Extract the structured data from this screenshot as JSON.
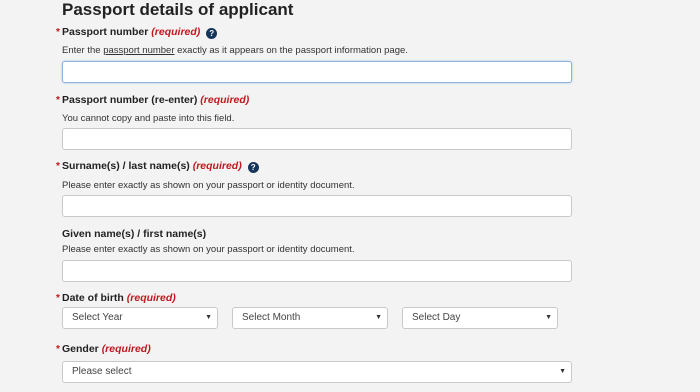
{
  "section": {
    "title": "Passport details of applicant"
  },
  "required_text": "(required)",
  "passport_number": {
    "label": "Passport number",
    "help_before": "Enter the ",
    "help_link": "passport number",
    "help_after": " exactly as it appears on the passport information page.",
    "value": ""
  },
  "passport_reenter": {
    "label": "Passport number (re-enter)",
    "help": "You cannot copy and paste into this field.",
    "value": ""
  },
  "surname": {
    "label": "Surname(s) / last name(s)",
    "help": "Please enter exactly as shown on your passport or identity document.",
    "value": ""
  },
  "given_name": {
    "label": "Given name(s) / first name(s)",
    "help": "Please enter exactly as shown on your passport or identity document.",
    "value": ""
  },
  "dob": {
    "label": "Date of birth",
    "year_placeholder": "Select Year",
    "month_placeholder": "Select Month",
    "day_placeholder": "Select Day"
  },
  "gender": {
    "label": "Gender",
    "placeholder": "Please select"
  },
  "icons": {
    "help": "question-circle-icon",
    "dropdown": "caret-down-icon",
    "required_marker": "asterisk"
  },
  "colors": {
    "required": "#c0181e",
    "help_icon": "#16355a",
    "focus_border": "#8fb2d8"
  }
}
